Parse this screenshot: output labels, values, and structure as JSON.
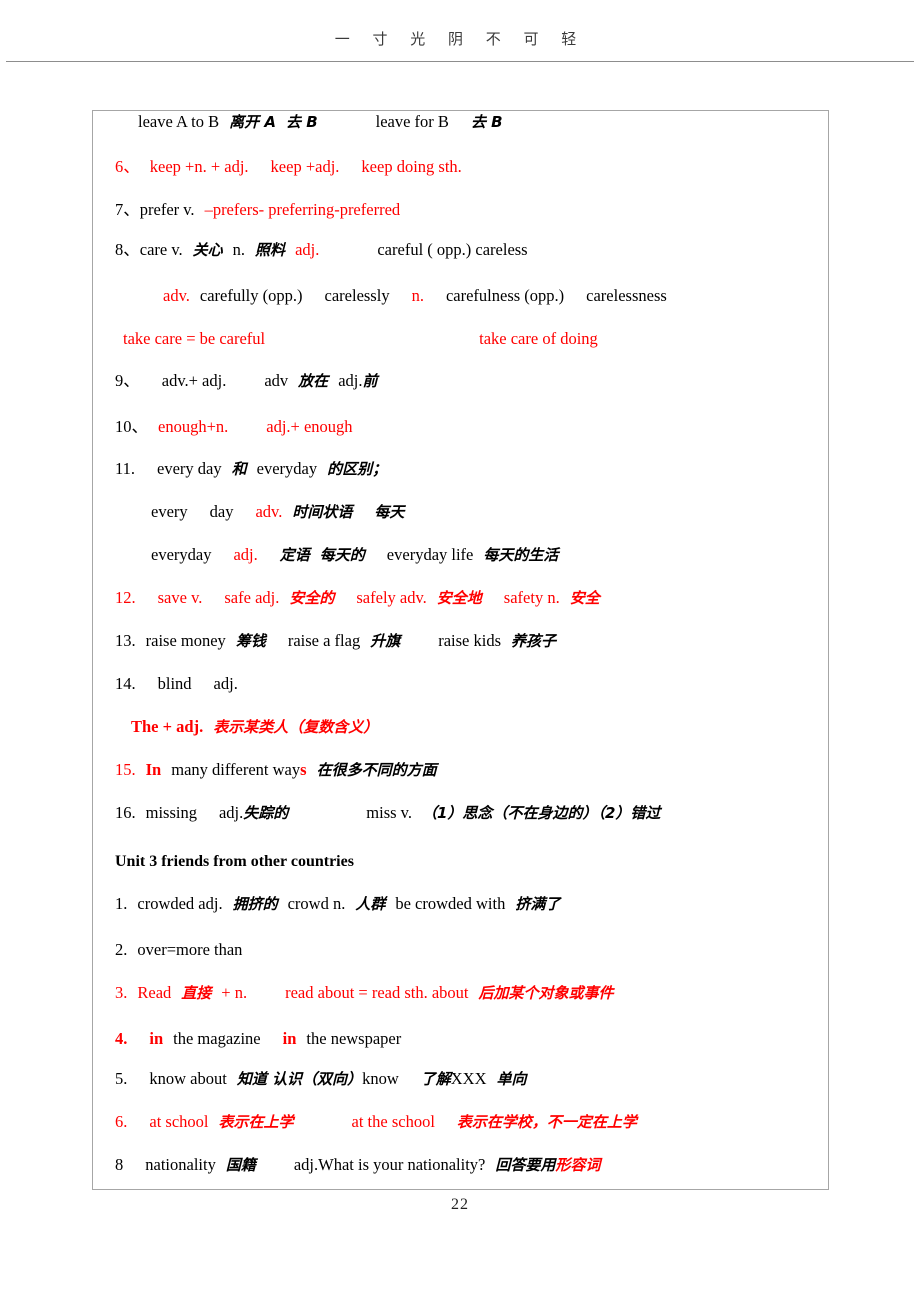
{
  "header": {
    "running_head": "一 寸 光 阴 不 可 轻"
  },
  "footer": {
    "page_number": "22"
  },
  "colors": {
    "red_accent": "#ff0000",
    "text": "#000000",
    "frame_border": "#a6a6a6",
    "header_rule": "#8d8d8d"
  },
  "notes": {
    "l1_a": "leave A to B",
    "l1_b": "离开 A",
    "l1_c": "去 B",
    "l1_d": "leave for B",
    "l1_e": "去 B",
    "l6_num": "6、",
    "l6_a": "keep +n. + adj.",
    "l6_b": "keep +adj.",
    "l6_c": "keep doing sth.",
    "l7_num": "7、",
    "l7_a": "prefer v.",
    "l7_b": "–prefers- preferring-preferred",
    "l8_num": "8、",
    "l8_a": "care v.",
    "l8_b": "关心",
    "l8_c": "n.",
    "l8_d": "照料",
    "l8_e": "adj.",
    "l8_f": "careful ( opp.) careless",
    "l8b_a": "adv.",
    "l8b_b": "carefully (opp.)",
    "l8b_c": "carelessly",
    "l8b_d": "n.",
    "l8b_e": "carefulness (opp.)",
    "l8b_f": "carelessness",
    "l8c_a": "take care = be careful",
    "l8c_b": "take care of doing",
    "l9_num": "9、",
    "l9_a": "adv.+ adj.",
    "l9_b": "adv",
    "l9_c": "放在",
    "l9_d": "adj.",
    "l9_e": "前",
    "l10_num": "10、",
    "l10_a": "enough+n.",
    "l10_b": "adj.+ enough",
    "l11_num": "11.",
    "l11_a": "every day",
    "l11_b": "和",
    "l11_c": "everyday",
    "l11_d": "的区别；",
    "l11b_a": "every",
    "l11b_b": "day",
    "l11b_c": "adv.",
    "l11b_d": "时间状语",
    "l11b_e": "每天",
    "l11c_a": "everyday",
    "l11c_b": "adj.",
    "l11c_c": "定语",
    "l11c_d": "每天的",
    "l11c_e": "everyday life",
    "l11c_f": "每天的生活",
    "l12_num": "12.",
    "l12_a": "save v.",
    "l12_b": "safe adj.",
    "l12_c": "安全的",
    "l12_d": "safely adv.",
    "l12_e": "安全地",
    "l12_f": "safety n.",
    "l12_g": "安全",
    "l13_num": "13.",
    "l13_a": "raise money",
    "l13_b": "筹钱",
    "l13_c": "raise a flag",
    "l13_d": "升旗",
    "l13_e": "raise kids",
    "l13_f": "养孩子",
    "l14_num": "14.",
    "l14_a": "blind",
    "l14_b": "adj.",
    "l14b_a": "The + adj.",
    "l14b_b": "表示某类人（复数含义）",
    "l15_num": "15.",
    "l15_a": "In",
    "l15_b": "many different way",
    "l15_c": "s",
    "l15_d": "在很多不同的方面",
    "l16_num": "16.",
    "l16_a": "missing",
    "l16_b": "adj.",
    "l16_c": "失踪的",
    "l16_d": "miss v.",
    "l16_e": "（1）思念（不在身边的）（2）错过",
    "unit3_heading": "Unit 3 friends from other countries",
    "u1_num": "1.",
    "u1_a": "crowded adj.",
    "u1_b": "拥挤的",
    "u1_c": "crowd n.",
    "u1_d": "人群",
    "u1_e": "be crowded with",
    "u1_f": "挤满了",
    "u2_num": "2.",
    "u2_a": "over=more than",
    "u3_num": "3.",
    "u3_a": "Read",
    "u3_b": "直接",
    "u3_c": "+ n.",
    "u3_d": "read about = read sth. about",
    "u3_e": "后加某个对象或事件",
    "u4_num": "4.",
    "u4_a": "in",
    "u4_b": "the magazine",
    "u4_c": "in",
    "u4_d": "the newspaper",
    "u5_num": "5.",
    "u5_a": "know about",
    "u5_b": "知道 认识（双向）",
    "u5_c": "know",
    "u5_d": "了解",
    "u5_e": "XXX",
    "u5_f": "单向",
    "u6_num": "6.",
    "u6_a": "at school",
    "u6_b": "表示在上学",
    "u6_c": "at the school",
    "u6_d": "表示在学校，不一定在上学",
    "u8_num": "8",
    "u8_a": "nationality",
    "u8_b": "国籍",
    "u8_c": "adj.What is your nationality?",
    "u8_d": "回答要用",
    "u8_e": "形容词"
  }
}
